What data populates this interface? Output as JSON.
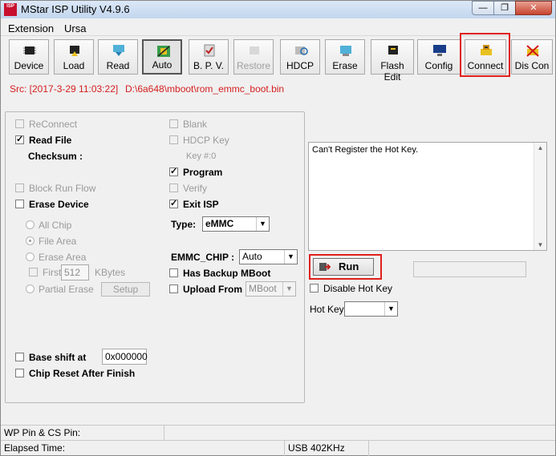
{
  "window": {
    "icon_text": "ISP",
    "title": "MStar ISP Utility V4.9.6",
    "controls": [
      "—",
      "❐",
      "✕"
    ]
  },
  "menu": [
    "Extension",
    "Ursa"
  ],
  "toolbar": [
    {
      "label": "Device",
      "icon": "chip-icon",
      "state": "normal"
    },
    {
      "label": "Load",
      "icon": "chip-load-icon",
      "state": "normal"
    },
    {
      "label": "Read",
      "icon": "read-arrow-icon",
      "state": "normal"
    },
    {
      "label": "Auto",
      "icon": "auto-icon",
      "state": "pressed"
    },
    {
      "label": "B. P. V.",
      "icon": "bpv-icon",
      "state": "normal"
    },
    {
      "label": "Restore",
      "icon": "restore-icon",
      "state": "disabled"
    },
    {
      "label": "HDCP",
      "icon": "hdcp-icon",
      "state": "normal"
    },
    {
      "label": "Erase",
      "icon": "erase-icon",
      "state": "normal"
    },
    {
      "label": "Flash Edit",
      "icon": "flash-edit-icon",
      "state": "normal"
    },
    {
      "label": "Config",
      "icon": "monitor-icon",
      "state": "normal"
    },
    {
      "label": "Connect",
      "icon": "connect-icon",
      "state": "normal"
    },
    {
      "label": "Dis Con",
      "icon": "disconnect-icon",
      "state": "normal"
    }
  ],
  "source": {
    "date": "Src: [2017-3-29 11:03:22]",
    "path": "D:\\6a648\\mboot\\rom_emmc_boot.bin"
  },
  "left_col": {
    "reconnect": "ReConnect",
    "read_file": "Read File",
    "checksum": "Checksum :",
    "block_run_flow": "Block Run Flow",
    "erase_device": "Erase Device",
    "all_chip": "All Chip",
    "file_area": "File Area",
    "erase_area": "Erase Area",
    "first": "First",
    "first_value": "512",
    "kbytes": "KBytes",
    "partial_erase": "Partial Erase",
    "setup": "Setup",
    "base_shift": "Base shift at",
    "base_shift_value": "0x000000",
    "chip_reset": "Chip Reset After Finish"
  },
  "mid_col": {
    "blank": "Blank",
    "hdcp_key": "HDCP Key",
    "key_num": "Key #:0",
    "program": "Program",
    "verify": "Verify",
    "exit_isp": "Exit ISP",
    "type_label": "Type:",
    "type_value": "eMMC",
    "emmc_chip_label": "EMMC_CHIP :",
    "emmc_chip_value": "Auto",
    "has_backup": "Has Backup MBoot",
    "upload_from": "Upload From",
    "upload_from_value": "MBoot"
  },
  "right": {
    "log_text": "Can't Register the Hot Key.",
    "run": "Run",
    "disable_hot_key": "Disable Hot Key",
    "hot_key": "Hot Key",
    "hot_key_value": ""
  },
  "status": {
    "wp_pin": "WP Pin & CS Pin:",
    "elapsed": "Elapsed Time:",
    "usb": "USB  402KHz"
  },
  "colors": {
    "highlight": "#e0201c",
    "source_text": "#d42020"
  }
}
